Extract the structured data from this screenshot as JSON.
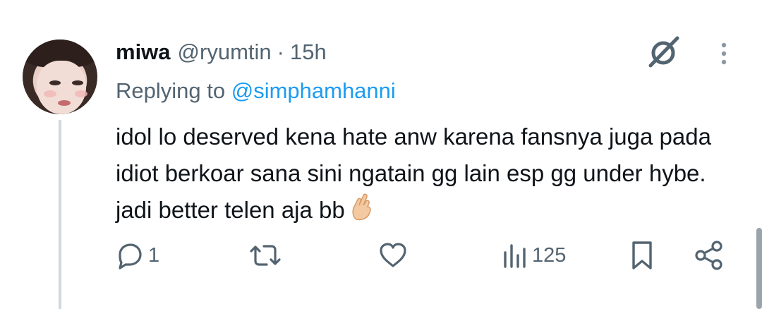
{
  "tweet": {
    "name": "miwa",
    "handle": "@ryumtin",
    "separator": "·",
    "time": "15h",
    "replying_prefix": "Replying to",
    "replying_to": "@simphamhanni",
    "text": "idol lo deserved kena hate anw karena fansnya juga pada idiot berkoar sana sini ngatain gg lain esp gg under hybe. jadi better telen aja bb",
    "emoji": "🤞"
  },
  "actions": {
    "reply_count": "1",
    "retweet_count": "",
    "like_count": "",
    "views_count": "125"
  },
  "icons": {
    "avatar": "user-avatar-photo",
    "grok": "grok-icon",
    "more": "more-vertical-icon",
    "reply": "reply-icon",
    "retweet": "retweet-icon",
    "like": "heart-icon",
    "views": "views-icon",
    "bookmark": "bookmark-icon",
    "share": "share-icon"
  },
  "colors": {
    "text": "#0f1419",
    "secondary": "#536471",
    "link": "#1d9bf0",
    "thread_line": "#cfd9de"
  }
}
